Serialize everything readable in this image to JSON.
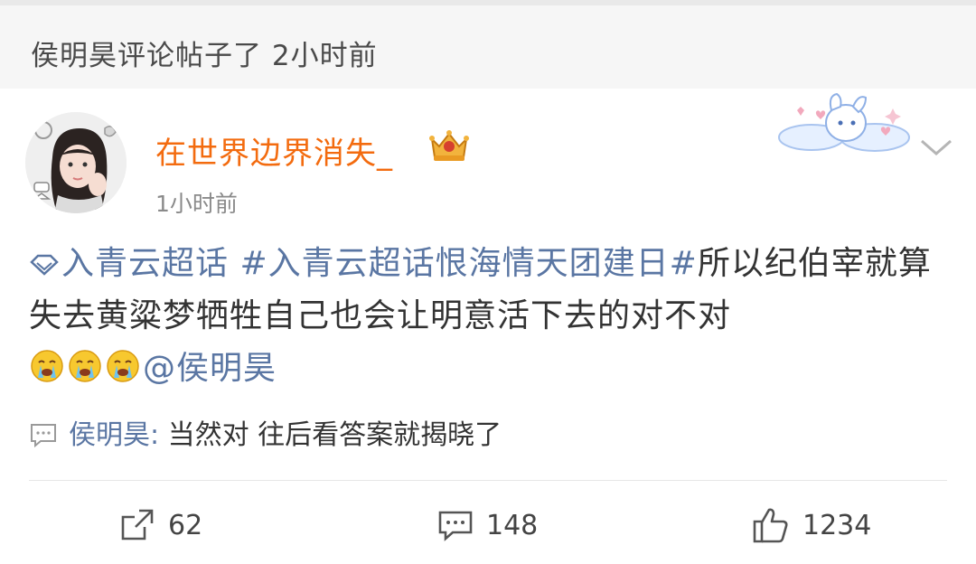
{
  "header": {
    "text": "侯明昊评论帖子了 2小时前"
  },
  "post": {
    "username": "在世界边界消失_",
    "time": "1小时前",
    "supertopic_label": "入青云超话",
    "hashtag": "#入青云超话恨海情天团建日#",
    "body": "所以纪伯宰就算失去黄粱梦牺牲自己也会让明意活下去的对不对",
    "emojis": [
      "crying-emoji",
      "crying-emoji",
      "crying-emoji"
    ],
    "mention": "@侯明昊"
  },
  "reply": {
    "name": "侯明昊:",
    "text": " 当然对 往后看答案就揭晓了"
  },
  "actions": {
    "repost_count": "62",
    "comment_count": "148",
    "like_count": "1234"
  },
  "colors": {
    "username": "#f36b0f",
    "topic": "#5a76a3",
    "header_bg": "#f6f6f6"
  }
}
